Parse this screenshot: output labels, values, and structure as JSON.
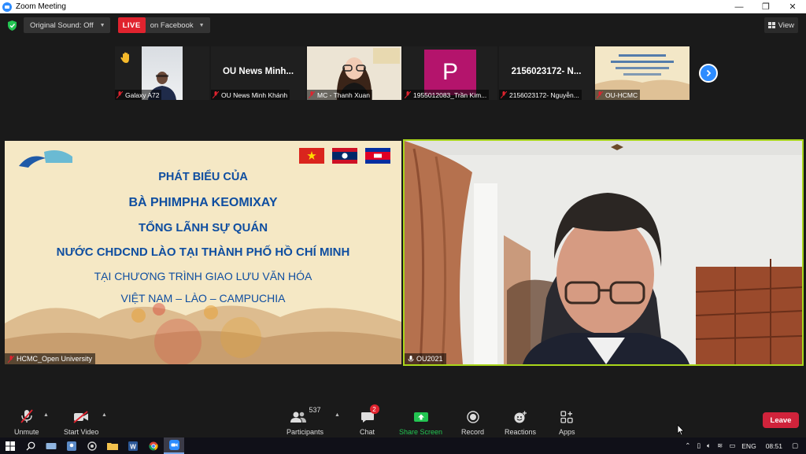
{
  "window": {
    "title": "Zoom Meeting",
    "minimize": "—",
    "maximize": "❐",
    "close": "✕"
  },
  "topbar": {
    "original_sound": "Original Sound: Off",
    "live_badge": "LIVE",
    "live_target": "on Facebook",
    "view_label": "View"
  },
  "filmstrip": [
    {
      "name": "Galaxy A72",
      "type": "camera",
      "hand_raised": true
    },
    {
      "name": "OU News Minh Khánh",
      "display": "OU News Minh...",
      "type": "name"
    },
    {
      "name": "MC - Thanh Xuan",
      "type": "camera"
    },
    {
      "name": "1955012083_Trần Kim...",
      "type": "avatar",
      "initial": "P"
    },
    {
      "name": "2156023172- Nguyễn...",
      "display": "2156023172- N...",
      "type": "name"
    },
    {
      "name": "OU-HCMC",
      "type": "camera"
    }
  ],
  "shared_slide": {
    "lines": [
      "PHÁT BIỂU CỦA",
      "BÀ PHIMPHA KEOMIXAY",
      "TỔNG LÃNH SỰ QUÁN",
      "NƯỚC CHDCND LÀO TẠI THÀNH PHỐ HỒ CHÍ MINH",
      "TẠI CHƯƠNG TRÌNH GIAO LƯU VĂN HÓA",
      "VIỆT NAM – LÀO – CAMPUCHIA"
    ],
    "participant": "HCMC_Open University"
  },
  "speaker": {
    "participant": "OU2021"
  },
  "toolbar": {
    "unmute": "Unmute",
    "start_video": "Start Video",
    "participants": "Participants",
    "participants_count": "537",
    "chat": "Chat",
    "chat_badge": "2",
    "share_screen": "Share Screen",
    "record": "Record",
    "reactions": "Reactions",
    "apps": "Apps",
    "leave": "Leave"
  },
  "taskbar": {
    "language": "ENG",
    "time": "08:51"
  },
  "colors": {
    "accent": "#2d8cff",
    "live": "#e0232e",
    "share": "#23c552",
    "leave": "#d0233b",
    "slide_text": "#0f4ea0",
    "speaker_border": "#a9d61b"
  }
}
